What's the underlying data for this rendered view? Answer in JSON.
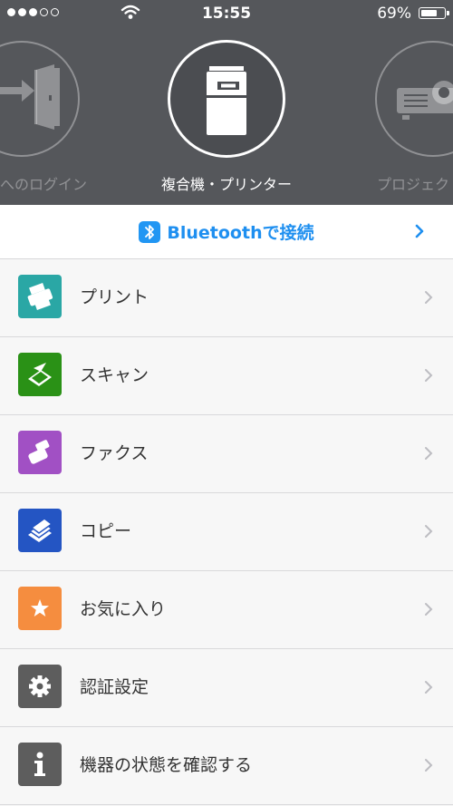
{
  "status_bar": {
    "time": "15:55",
    "battery": "69%",
    "battery_level": 0.69,
    "signal_bars": 3
  },
  "carousel": {
    "left_label": "へのログイン",
    "center_label": "複合機・プリンター",
    "right_label": "プロジェク",
    "left_icon": "login-door-icon",
    "center_icon": "multifunction-printer-icon",
    "right_icon": "projector-icon"
  },
  "bluetooth": {
    "label": "Bluetoothで接続",
    "icon": "bluetooth-icon"
  },
  "menu": {
    "items": [
      {
        "label": "プリント",
        "icon": "printer-icon",
        "color": "#2aa7a5"
      },
      {
        "label": "スキャン",
        "icon": "scanner-icon",
        "color": "#2a9116"
      },
      {
        "label": "ファクス",
        "icon": "fax-icon",
        "color": "#a150c4"
      },
      {
        "label": "コピー",
        "icon": "copy-icon",
        "color": "#2455c3"
      },
      {
        "label": "お気に入り",
        "icon": "star-icon",
        "color": "#f58d3f"
      },
      {
        "label": "認証設定",
        "icon": "gear-icon",
        "color": "#5d5d5d"
      },
      {
        "label": "機器の状態を確認する",
        "icon": "info-icon",
        "color": "#5d5d5d"
      }
    ]
  },
  "colors": {
    "header_bg": "#55575b",
    "accent_blue": "#1e8ff0"
  }
}
